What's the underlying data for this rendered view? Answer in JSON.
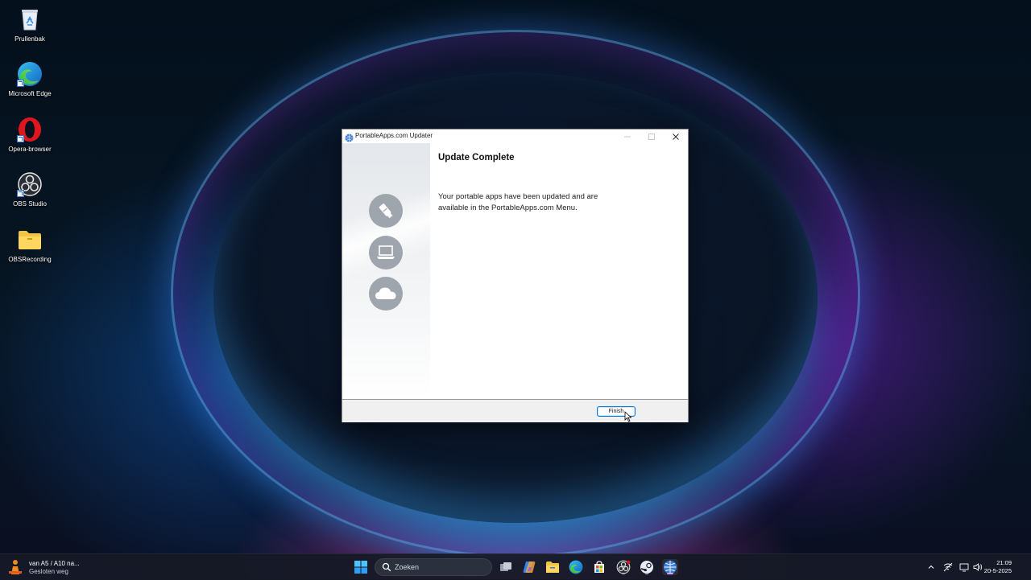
{
  "desktop": {
    "icons": [
      {
        "label": "Prullenbak",
        "icon": "recycle-bin-icon"
      },
      {
        "label": "Microsoft Edge",
        "icon": "edge-icon"
      },
      {
        "label": "Opera-browser",
        "icon": "opera-icon"
      },
      {
        "label": "OBS Studio",
        "icon": "obs-icon"
      },
      {
        "label": "OBSRecording",
        "icon": "folder-icon"
      }
    ]
  },
  "dialog": {
    "title": "PortableApps.com Updater",
    "heading": "Update Complete",
    "message": "Your portable apps have been updated and are available in the PortableApps.com Menu.",
    "finish_label": "Finish",
    "sidebar_icons": [
      "usb-drive-icon",
      "laptop-icon",
      "cloud-icon"
    ]
  },
  "taskbar": {
    "news": {
      "line1": "van A5 / A10 na...",
      "line2": "Gesloten weg"
    },
    "search_placeholder": "Zoeken",
    "apps": [
      "start-icon",
      "search-icon",
      "task-view-icon",
      "copilot-icon",
      "file-explorer-icon",
      "edge-icon",
      "store-icon",
      "obs-icon",
      "steam-icon",
      "portableapps-icon"
    ],
    "clock": {
      "time": "21:09",
      "date": "20-5-2025"
    }
  },
  "colors": {
    "accent": "#0078d4",
    "sidebar_circle": "#9ea5ac",
    "taskbar": "#161a26"
  }
}
